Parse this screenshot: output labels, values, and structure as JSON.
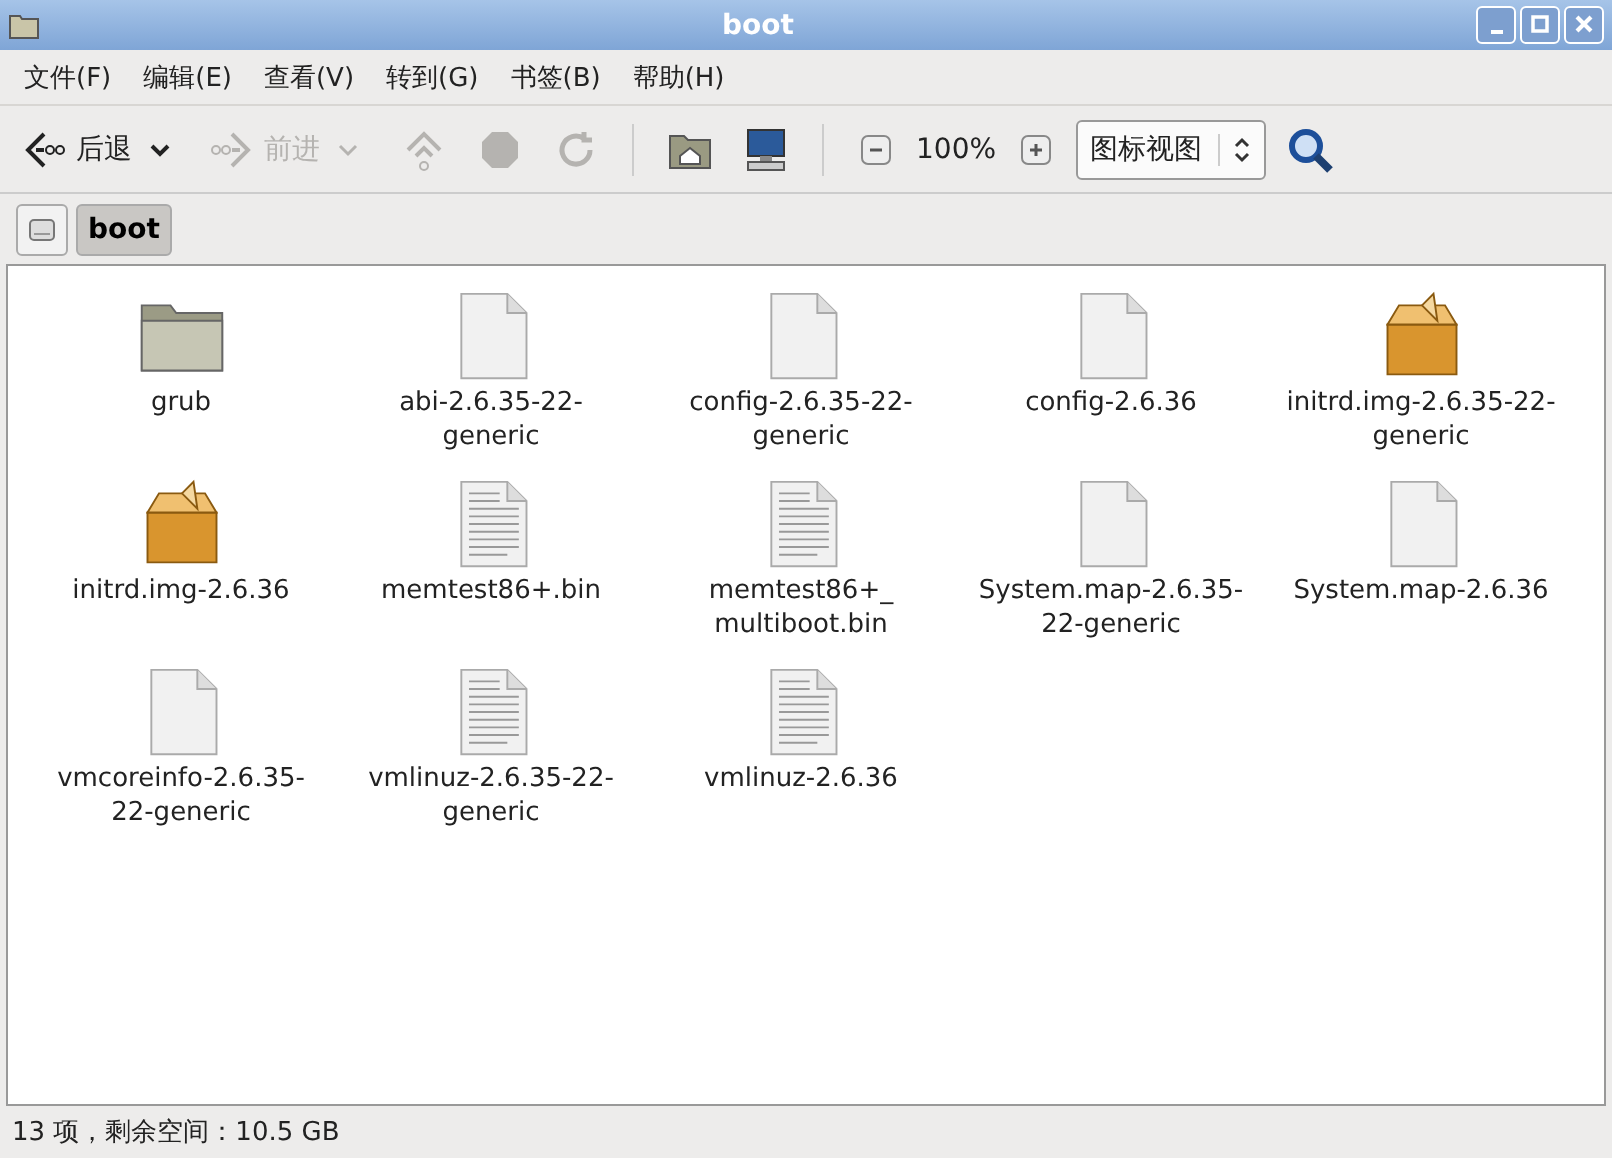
{
  "window": {
    "title": "boot"
  },
  "menu": [
    "文件(F)",
    "编辑(E)",
    "查看(V)",
    "转到(G)",
    "书签(B)",
    "帮助(H)"
  ],
  "toolbar": {
    "back": {
      "label": "后退",
      "disabled": false
    },
    "forward": {
      "label": "前进",
      "disabled": true
    },
    "up_disabled": true,
    "stop_disabled": true,
    "reload_disabled": true,
    "zoom": "100%",
    "view": "图标视图"
  },
  "path": [
    {
      "label": "boot",
      "selected": true
    }
  ],
  "files": [
    {
      "kind": "folder",
      "name": [
        "grub"
      ]
    },
    {
      "kind": "blank",
      "name": [
        "abi-2.6.35-22-",
        "generic"
      ]
    },
    {
      "kind": "blank",
      "name": [
        "config-2.6.35-22-",
        "generic"
      ]
    },
    {
      "kind": "blank",
      "name": [
        "config-2.6.36"
      ]
    },
    {
      "kind": "package",
      "name": [
        "initrd.img-2.6.35-22-",
        "generic"
      ]
    },
    {
      "kind": "package",
      "name": [
        "initrd.img-2.6.36"
      ]
    },
    {
      "kind": "text",
      "name": [
        "memtest86+.bin"
      ]
    },
    {
      "kind": "text",
      "name": [
        "memtest86+_",
        "multiboot.bin"
      ]
    },
    {
      "kind": "blank",
      "name": [
        "System.map-2.6.35-",
        "22-generic"
      ]
    },
    {
      "kind": "blank",
      "name": [
        "System.map-2.6.36"
      ]
    },
    {
      "kind": "blank",
      "name": [
        "vmcoreinfo-2.6.35-",
        "22-generic"
      ]
    },
    {
      "kind": "text",
      "name": [
        "vmlinuz-2.6.35-22-",
        "generic"
      ]
    },
    {
      "kind": "text",
      "name": [
        "vmlinuz-2.6.36"
      ]
    }
  ],
  "status_bar": "13 项，剩余空间：10.5 GB"
}
